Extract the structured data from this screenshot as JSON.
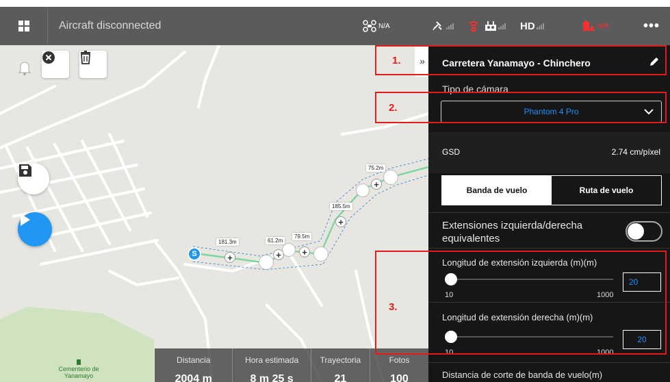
{
  "statusbar": {
    "connection": "Aircraft disconnected",
    "drone_status": "N/A",
    "hd_label": "HD",
    "warning_status": "N/A"
  },
  "map": {
    "cemetery_label": "Cementerio de Yanamayo",
    "start_label": "S",
    "segment_lengths": [
      "181.3m",
      "61.2m",
      "79.5m",
      "185.5m",
      "75.2m"
    ]
  },
  "stats": [
    {
      "header": "Distancia",
      "value": "2004 m"
    },
    {
      "header": "Hora estimada",
      "value": "8 m 25 s"
    },
    {
      "header": "Trayectoria",
      "value": "21"
    },
    {
      "header": "Fotos",
      "value": "100"
    }
  ],
  "panel": {
    "title": "Carretera Yanamayo - Chinchero",
    "camera_type_label": "Tipo de cámara",
    "camera_value": "Phantom 4 Pro",
    "gsd_label": "GSD",
    "gsd_value": "2.74 cm/píxel",
    "segment_options": [
      "Banda de vuelo",
      "Ruta de vuelo"
    ],
    "selected_segment": "Banda de vuelo",
    "equal_extensions_label": "Extensiones izquierda/derecha equivalentes",
    "equal_extensions_on": false,
    "left_ext": {
      "label": "Longitud de extensión izquierda (m)(m)",
      "min": "10",
      "max": "1000",
      "value": "20"
    },
    "right_ext": {
      "label": "Longitud de extensión derecha (m)(m)",
      "min": "10",
      "max": "1000",
      "value": "20"
    },
    "cut_label": "Distancia de corte de banda de vuelo(m)"
  },
  "annotations": [
    "1.",
    "2.",
    "3."
  ],
  "colors": {
    "accent": "#1e90ff",
    "annotation_red": "#e31b1b",
    "play_button": "#2196f3",
    "route_green": "#7ed6a0"
  }
}
